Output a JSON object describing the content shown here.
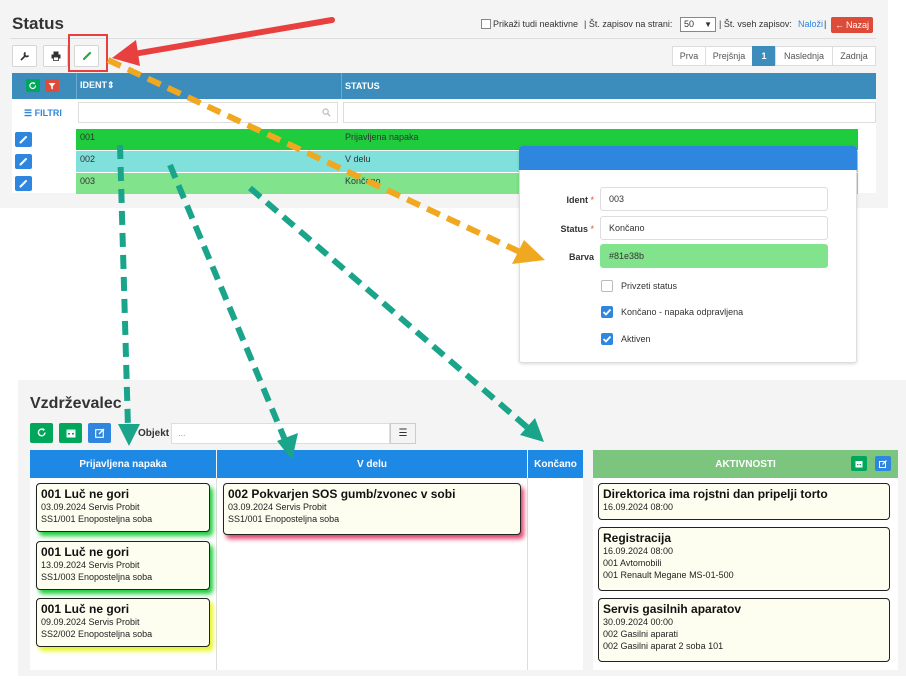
{
  "status_page": {
    "title": "Status",
    "show_inactive_label": "Prikaži tudi neaktivne",
    "per_page_label": "| Št. zapisov na strani:",
    "per_page_value": "50",
    "total_label": "| Št. vseh zapisov:",
    "total_link": "Naloži",
    "back_label": "Nazaj",
    "pagination": [
      "Prva",
      "Prejšnja",
      "1",
      "Naslednja",
      "Zadnja"
    ],
    "filter_label": "FILTRI",
    "col_ident": "IDENT",
    "col_status": "STATUS",
    "rows": [
      {
        "ident": "001",
        "status": "Prijavljena napaka",
        "color": "#1fcc3d"
      },
      {
        "ident": "002",
        "status": "V delu",
        "color": "#7fe0dc"
      },
      {
        "ident": "003",
        "status": "Končano",
        "color": "#81e38b"
      }
    ]
  },
  "edit_form": {
    "ident_label": "Ident",
    "ident_value": "003",
    "status_label": "Status",
    "status_value": "Končano",
    "barva_label": "Barva",
    "barva_value": "#81e38b",
    "chk_default": "Privzeti status",
    "chk_done": "Končano - napaka odpravljena",
    "chk_active": "Aktiven",
    "required_mark": "*"
  },
  "board": {
    "title": "Vzdrževalec",
    "objekt_label": "Objekt",
    "objekt_placeholder": "...",
    "columns": [
      {
        "label": "Prijavljena napaka",
        "color": "#1e88e5"
      },
      {
        "label": "V delu",
        "color": "#1e88e5"
      },
      {
        "label": "Končano",
        "color": "#1e88e5"
      },
      {
        "label": "AKTIVNOSTI",
        "color": "#7cc57f"
      }
    ],
    "cards_prijavljena": [
      {
        "title": "001 Luč ne gori",
        "line1": "03.09.2024 Servis Probit",
        "line2": "SS1/001 Enoposteljna soba",
        "glow": "#1fcc3d"
      },
      {
        "title": "001 Luč ne gori",
        "line1": "13.09.2024 Servis Probit",
        "line2": "SS1/003 Enoposteljna soba",
        "glow": "#1fcc3d"
      },
      {
        "title": "001 Luč ne gori",
        "line1": "09.09.2024 Servis Probit",
        "line2": "SS2/002 Enoposteljna soba",
        "glow": "#e6f51f"
      }
    ],
    "cards_vdelu": [
      {
        "title": "002 Pokvarjen SOS gumb/zvonec v sobi",
        "line1": "03.09.2024 Servis Probit",
        "line2": "SS1/001 Enoposteljna soba",
        "glow": "#e0456e"
      }
    ],
    "activities": [
      {
        "title": "Direktorica ima rojstni dan pripelji torto",
        "lines": [
          "16.09.2024 08:00"
        ]
      },
      {
        "title": "Registracija",
        "lines": [
          "16.09.2024 08:00",
          "001 Avtomobili",
          "001 Renault Megane MS-01-500"
        ]
      },
      {
        "title": "Servis gasilnih aparatov",
        "lines": [
          "30.09.2024 00:00",
          "002 Gasilni aparati",
          "002 Gasilni aparat 2 soba 101"
        ]
      }
    ]
  },
  "colors": {
    "primary": "#3c8dbc",
    "danger": "#dd4b39",
    "success": "#00a65a",
    "arrow_red": "#e8403e",
    "arrow_orange": "#f0a820",
    "arrow_teal": "#1aa58a"
  }
}
